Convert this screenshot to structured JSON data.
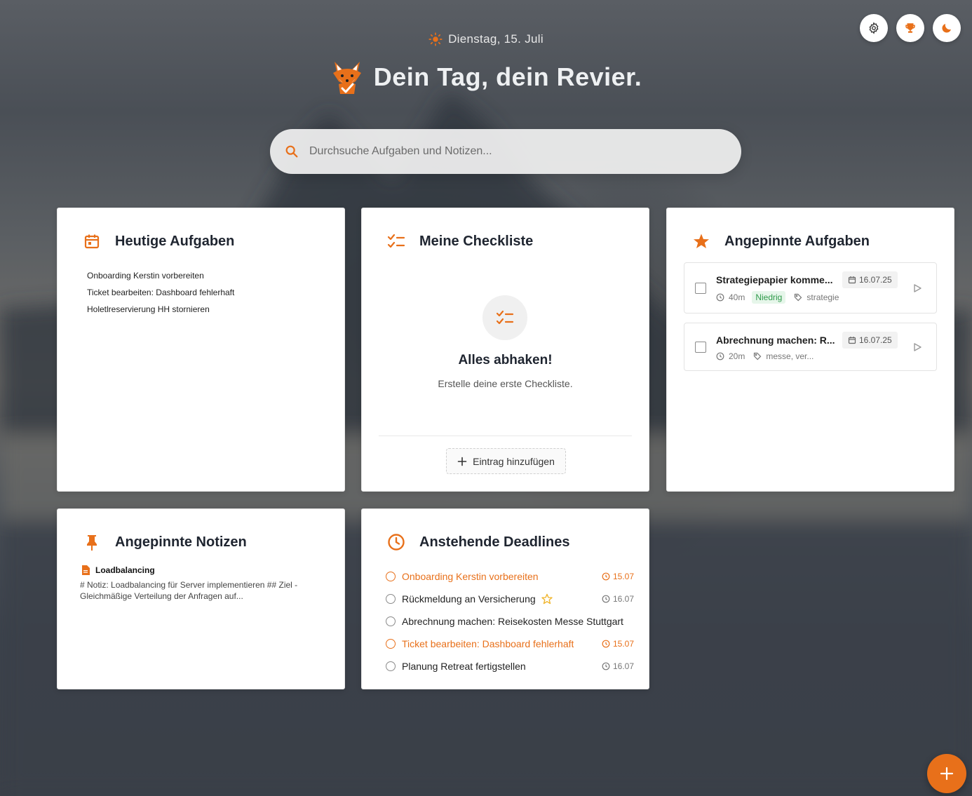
{
  "header": {
    "date": "Dienstag, 15. Juli",
    "title": "Dein Tag, dein Revier."
  },
  "search": {
    "placeholder": "Durchsuche Aufgaben und Notizen..."
  },
  "top_buttons": [
    {
      "icon": "gear-icon"
    },
    {
      "icon": "trophy-icon"
    },
    {
      "icon": "moon-icon"
    }
  ],
  "today": {
    "title": "Heutige Aufgaben",
    "tasks": [
      "Onboarding Kerstin vorbereiten",
      "Ticket bearbeiten: Dashboard fehlerhaft",
      "Holetlreservierung HH stornieren"
    ]
  },
  "checklist": {
    "title": "Meine Checkliste",
    "empty_title": "Alles abhaken!",
    "empty_sub": "Erstelle deine erste Checkliste.",
    "add_label": "Eintrag hinzufügen"
  },
  "pinned_tasks": {
    "title": "Angepinnte Aufgaben",
    "items": [
      {
        "title": "Strategiepapier komme...",
        "date": "16.07.25",
        "duration": "40m",
        "priority": "Niedrig",
        "tags": "strategie"
      },
      {
        "title": "Abrechnung machen: R...",
        "date": "16.07.25",
        "duration": "20m",
        "tags": "messe, ver..."
      }
    ]
  },
  "pinned_notes": {
    "title": "Angepinnte Notizen",
    "note_title": "Loadbalancing",
    "note_body": "# Notiz: Loadbalancing für Server implementieren ## Ziel - Gleichmäßige Verteilung der Anfragen auf..."
  },
  "deadlines": {
    "title": "Anstehende Deadlines",
    "items": [
      {
        "text": "Onboarding Kerstin vorbereiten",
        "date": "15.07",
        "overdue": true
      },
      {
        "text": "Rückmeldung an Versicherung",
        "date": "16.07",
        "starred": true
      },
      {
        "text": "Abrechnung machen: Reisekosten Messe Stuttgart",
        "date": ""
      },
      {
        "text": "Ticket bearbeiten: Dashboard fehlerhaft",
        "date": "15.07",
        "overdue": true
      },
      {
        "text": "Planung Retreat fertigstellen",
        "date": "16.07"
      }
    ]
  },
  "colors": {
    "accent": "#e8701a",
    "priority_low": "#2e9a4a"
  }
}
